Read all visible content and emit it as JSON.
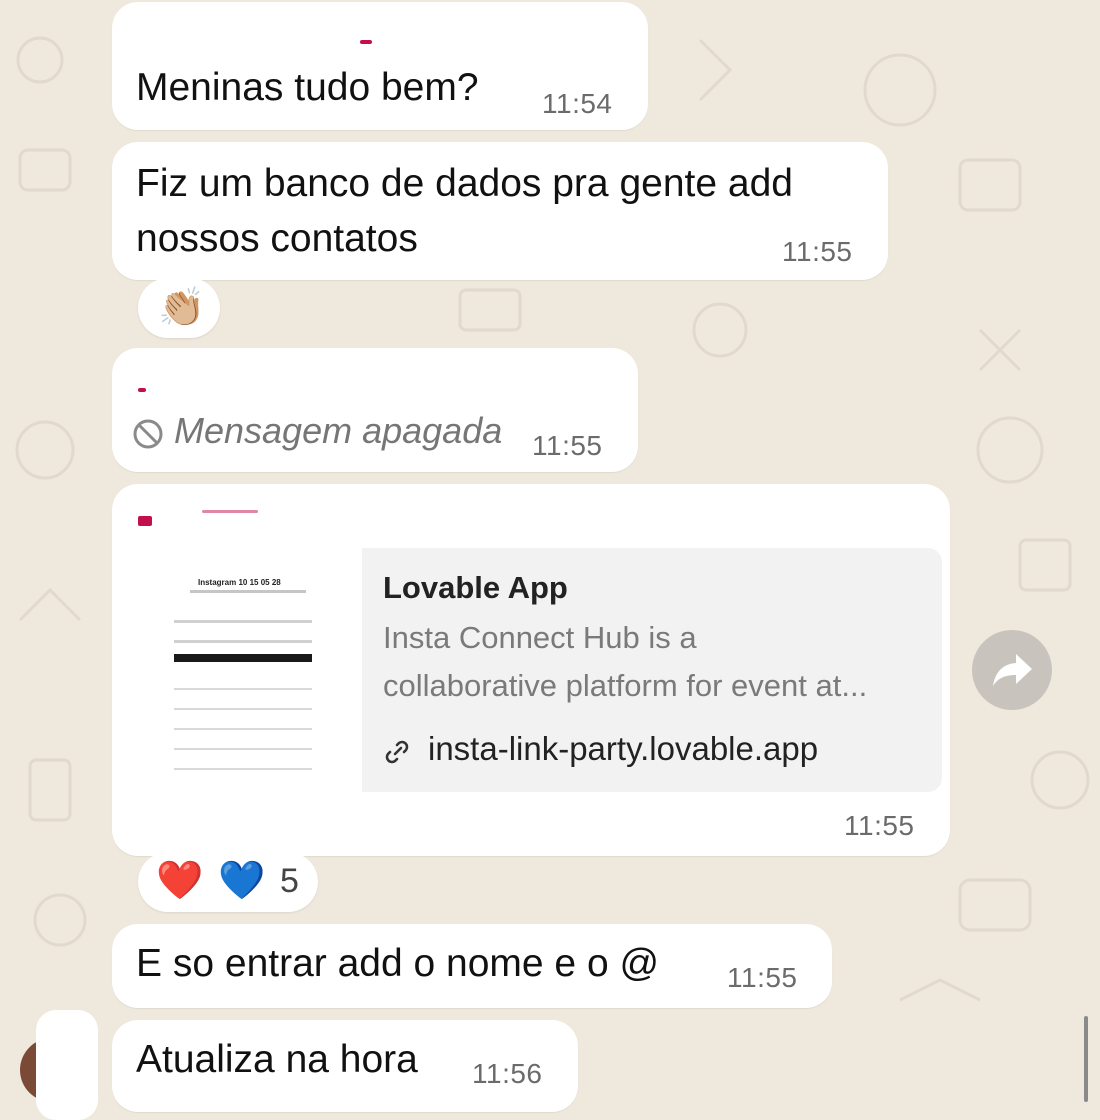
{
  "messages": [
    {
      "text": "Meninas tudo bem?",
      "time": "11:54"
    },
    {
      "text_line1": "Fiz um banco de dados pra gente add",
      "text_line2": "nossos contatos",
      "time": "11:55",
      "reaction": "👏🏼"
    },
    {
      "deleted_text": "Mensagem apagada",
      "time": "11:55"
    },
    {
      "link_preview": {
        "title": "Lovable App",
        "description_line1": "Insta Connect Hub is a",
        "description_line2": "collaborative platform for event at...",
        "url": "insta-link-party.lovable.app",
        "thumb_heading": "Instagram 10 15 05 28"
      },
      "time": "11:55",
      "reactions": {
        "emoji1": "❤️",
        "emoji2": "💙",
        "count": "5"
      }
    },
    {
      "text": "E so entrar add o nome e o @",
      "time": "11:55"
    },
    {
      "text": "Atualiza na hora",
      "time": "11:56"
    }
  ],
  "icons": {
    "deleted": "block-icon",
    "link": "link-icon",
    "forward": "forward-arrow-icon"
  },
  "colors": {
    "background": "#efe8dc",
    "bubble": "#ffffff",
    "sender_accent": "#c4104a",
    "time": "#6b6b6b"
  }
}
